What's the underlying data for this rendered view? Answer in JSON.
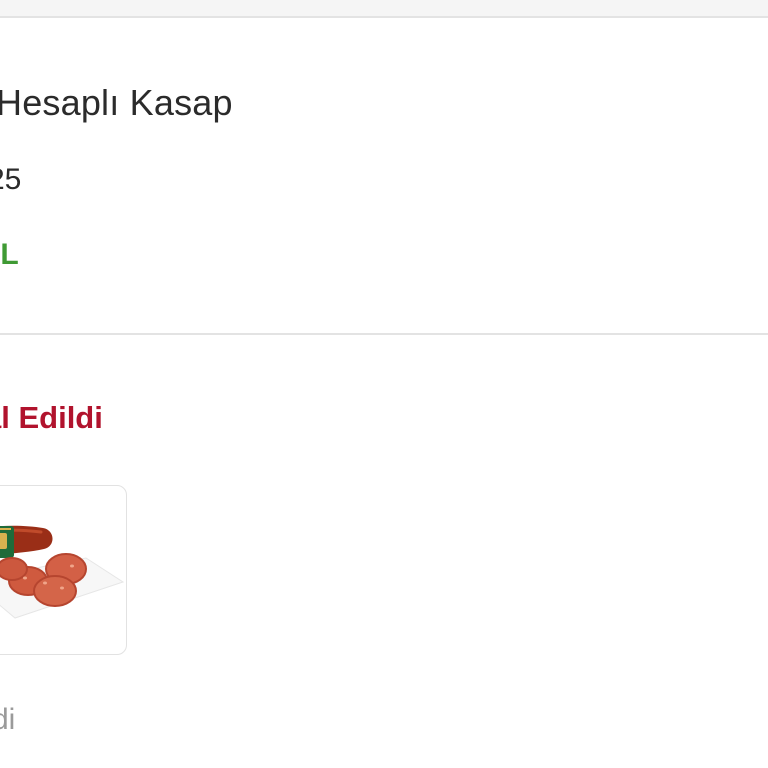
{
  "order": {
    "shop_name": "Hesaplı Kasap",
    "order_number_fragment": "25",
    "total_fragment": "TL"
  },
  "status": {
    "title_fragment": "al Edildi",
    "note_fragment": "di"
  },
  "product": {
    "image_alt": "sucuk-image"
  },
  "colors": {
    "total": "#3f9a34",
    "status_title": "#b1132d",
    "divider": "#e3e3e3",
    "muted_text": "#9a9a9a"
  }
}
